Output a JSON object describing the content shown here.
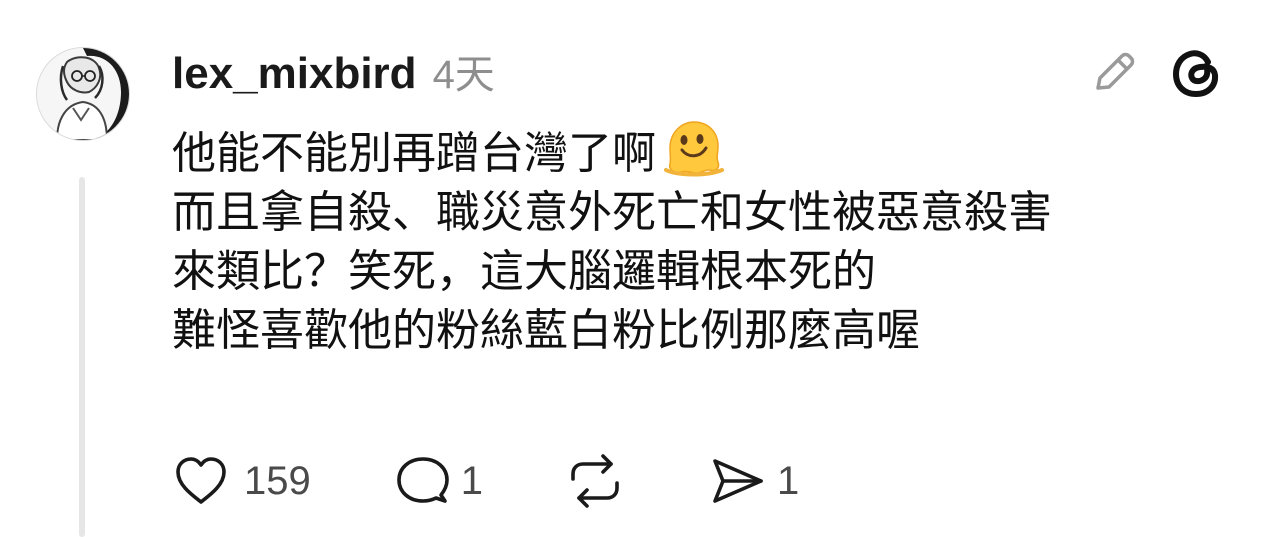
{
  "post": {
    "username": "lex_mixbird",
    "time_ago": "4天",
    "lines": [
      "他能不能別再蹭台灣了啊",
      "而且拿自殺、職災意外死亡和女性被惡意殺害",
      "來類比？笑死，這大腦邏輯根本死的",
      "難怪喜歡他的粉絲藍白粉比例那麼高喔"
    ],
    "emoji": "melting-face-emoji"
  },
  "actions": {
    "likes": "159",
    "replies": "1",
    "reposts": "",
    "shares": "1"
  },
  "icons": [
    "edit-icon",
    "threads-logo-icon",
    "heart-icon",
    "comment-icon",
    "repost-icon",
    "share-icon"
  ],
  "colors": {
    "text": "#111111",
    "muted": "#8e8e8e",
    "icon": "#1a1a1a",
    "thread_line": "#e6e6e6"
  }
}
